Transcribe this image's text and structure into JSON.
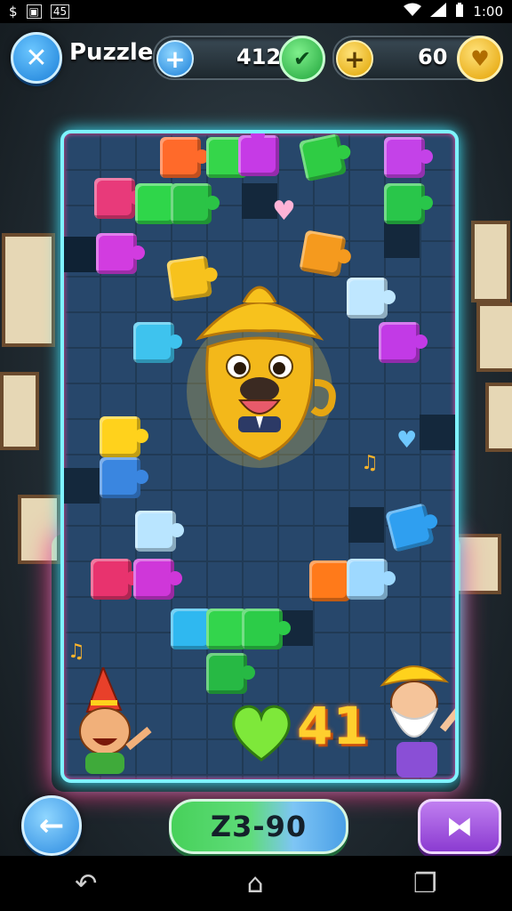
{
  "status_bar": {
    "left_icons": [
      "$",
      "▣",
      "45"
    ],
    "right_text": "1:00"
  },
  "header": {
    "title": "Puzzle",
    "close_glyph": "✕",
    "currency_1": {
      "value": "412",
      "plus": "+",
      "badge": "✔"
    },
    "currency_2": {
      "value": "60",
      "plus": "+",
      "badge": "♥"
    }
  },
  "board": {
    "score_value": "41"
  },
  "footer": {
    "back_glyph": "←",
    "center_label": "Z3-90",
    "next_glyph": "⧓"
  },
  "nav": {
    "back": "↶",
    "home": "⌂",
    "recents": "❐"
  },
  "colors": {
    "board_border": "#7ff3ff",
    "accent_pink": "#ff3d8a",
    "green_button": "#47d15a",
    "purple_button": "#8b3bd1"
  }
}
